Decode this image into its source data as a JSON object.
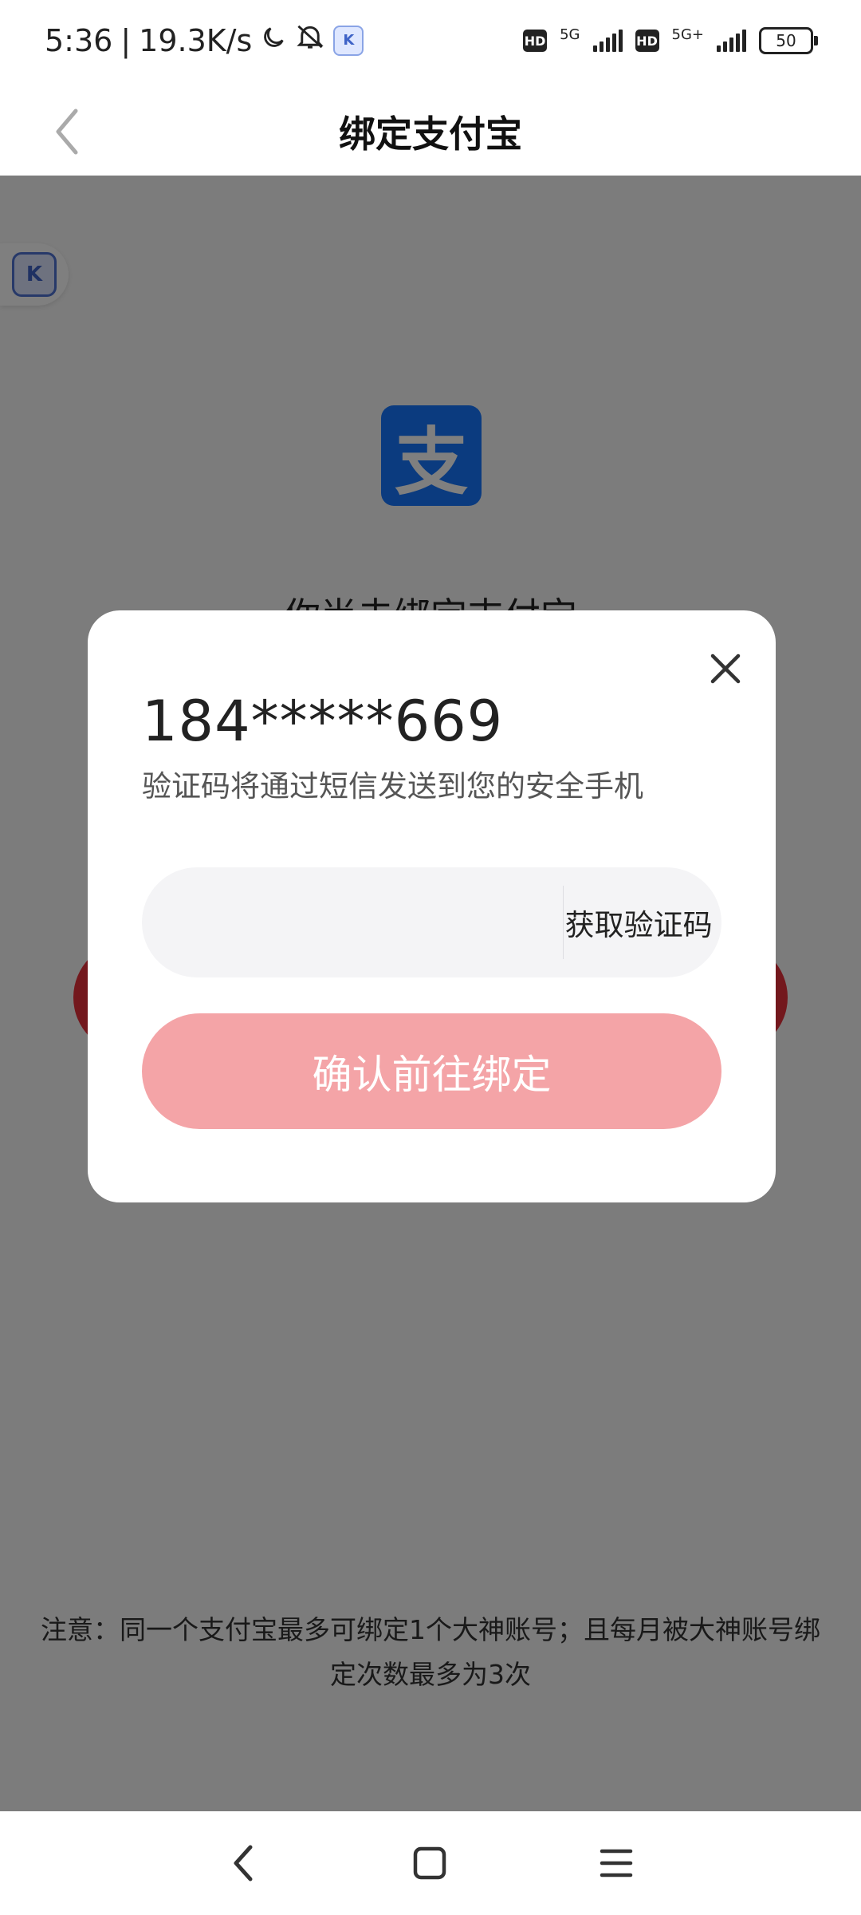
{
  "status_bar": {
    "time": "5:36",
    "separator": "|",
    "net_speed": "19.3K/s",
    "sim1_net": "5G",
    "sim2_net": "5G+",
    "hd_label": "HD",
    "battery_level": "50",
    "app_badge_letter": "K"
  },
  "header": {
    "title": "绑定支付宝"
  },
  "background": {
    "alipay_logo_char": "支",
    "heading": "你尚未绑定支付宝",
    "floating_badge_letter": "K",
    "notice": "注意：同一个支付宝最多可绑定1个大神账号；且每月被大神账号绑定次数最多为3次"
  },
  "modal": {
    "phone": "184*****669",
    "hint": "验证码将通过短信发送到您的安全手机",
    "code_input_value": "",
    "code_input_placeholder": "",
    "get_code_label": "获取验证码",
    "confirm_label": "确认前往绑定"
  },
  "colors": {
    "alipay_blue": "#1677ff",
    "confirm_button": "#f4a4a7",
    "overlay": "rgba(0,0,0,0.5)"
  }
}
